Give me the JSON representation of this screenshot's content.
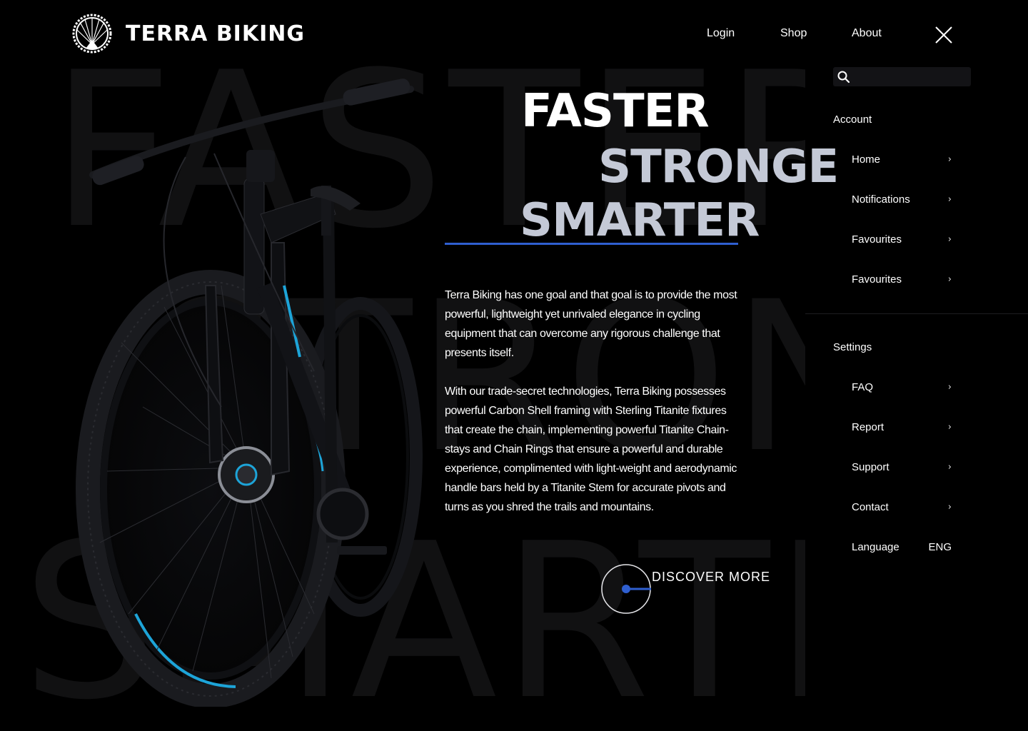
{
  "brand": {
    "name": "TERRA BIKING"
  },
  "background_words": [
    "FASTER",
    "STRON",
    "SMARTI"
  ],
  "nav": {
    "login": "Login",
    "shop": "Shop",
    "about": "About"
  },
  "hero": {
    "line1": "FASTER",
    "line2": "STRONGE",
    "line3": "SMARTER",
    "paragraph1": "Terra Biking has one goal and that goal is to provide the most powerful, lightweight yet unrivaled elegance in cycling equipment that can overcome any rigorous challenge that presents itself.",
    "paragraph2": "With our trade-secret technologies, Terra Biking possesses powerful Carbon Shell framing with Sterling Titanite fixtures that create the chain, implementing powerful Titanite Chain-stays and Chain Rings that ensure a powerful and durable experience, complimented with light-weight and aerodynamic handle bars held by a Titanite Stem for accurate pivots and turns as you shred the trails and mountains.",
    "cta": "DISCOVER MORE"
  },
  "panel": {
    "search": {
      "value": "",
      "placeholder": ""
    },
    "account_title": "Account",
    "account_items": [
      {
        "label": "Home",
        "icon": "chevron-right-icon"
      },
      {
        "label": "Notifications",
        "icon": "chevron-right-icon"
      },
      {
        "label": "Favourites",
        "icon": "chevron-right-icon"
      },
      {
        "label": "Favourites",
        "icon": "chevron-right-icon"
      }
    ],
    "settings_title": "Settings",
    "settings_items": [
      {
        "label": "FAQ",
        "icon": "chevron-right-icon"
      },
      {
        "label": "Report",
        "icon": "chevron-right-icon"
      },
      {
        "label": "Support",
        "icon": "chevron-right-icon"
      },
      {
        "label": "Contact",
        "icon": "chevron-right-icon"
      }
    ],
    "language_label": "Language",
    "language_value": "ENG"
  },
  "colors": {
    "accent": "#2f5fd0",
    "headline_secondary": "#c4c9d6",
    "background": "#000000"
  },
  "icons": [
    "bike-wheel-logo-icon",
    "close-icon",
    "search-icon",
    "chevron-right-icon"
  ]
}
